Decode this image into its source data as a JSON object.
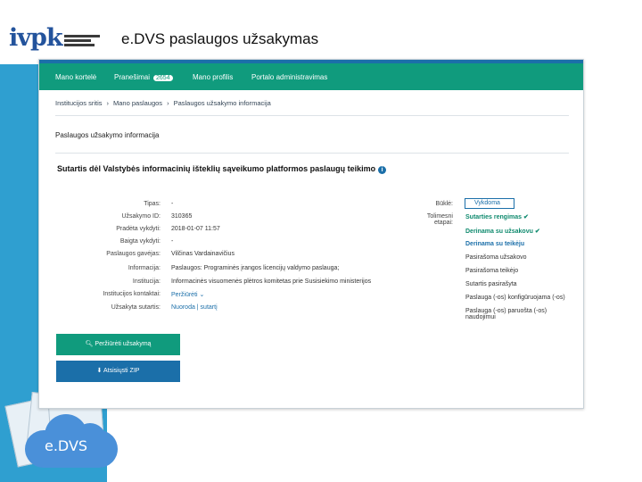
{
  "slide_title": "e.DVS paslaugos užsakymas",
  "logo": {
    "text": "ivpk"
  },
  "cloud_label": "e.DVS",
  "nav": {
    "items": [
      "Mano kortelė",
      "Pranešimai",
      "Mano profilis",
      "Portalo administravimas"
    ],
    "badge": "2654"
  },
  "breadcrumb": [
    "Institucijos sritis",
    "Mano paslaugos",
    "Paslaugos užsakymo informacija"
  ],
  "section_title": "Paslaugos užsakymo informacija",
  "contract_title": "Sutartis dėl Valstybės informacinių išteklių sąveikumo platformos paslaugų teikimo",
  "details": [
    {
      "label": "Tipas:",
      "value": "-"
    },
    {
      "label": "Užsakymo ID:",
      "value": "310365"
    },
    {
      "label": "Pradėta vykdyti:",
      "value": "2018-01-07 11:57"
    },
    {
      "label": "Baigta vykdyti:",
      "value": "-"
    },
    {
      "label": "Paslaugos gavėjas:",
      "value": "Vilčinas Vardainavičius"
    },
    {
      "label": "Informacija:",
      "value": "Paslaugos: Programinės įrangos licencijų valdymo paslauga;"
    },
    {
      "label": "Institucija:",
      "value": "Informacinės visuomenės plėtros komitetas prie Susisiekimo ministerijos"
    },
    {
      "label": "Institucijos kontaktai:",
      "value": "Peržiūrėti"
    },
    {
      "label": "Užsakyta sutartis:",
      "value": "Nuoroda | sutartį"
    }
  ],
  "status": {
    "bukle_label": "Būklė:",
    "bukle_value": "Vykdoma",
    "steps_label": "Tolimesni etapai:",
    "steps": [
      "Sutarties rengimas",
      "Derinama su užsakovu",
      "Derinama su teikėju",
      "Pasirašoma užsakovo",
      "Pasirašoma teikėjo",
      "Sutartis pasirašyta",
      "Paslauga (-os) konfigūruojama (-os)",
      "Paslauga (-os) paruošta (-os) naudojimui"
    ]
  },
  "buttons": {
    "view_order": "Peržiūrėti užsakymą",
    "download_zip": "Atsisiųsti ZIP"
  }
}
